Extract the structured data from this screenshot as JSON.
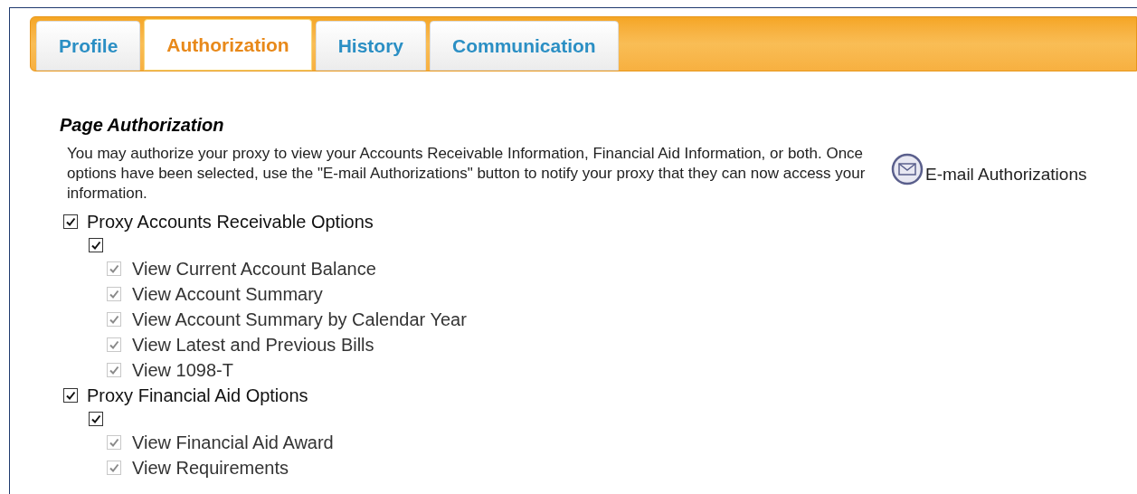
{
  "tabs": [
    {
      "label": "Profile",
      "selected": false
    },
    {
      "label": "Authorization",
      "selected": true
    },
    {
      "label": "History",
      "selected": false
    },
    {
      "label": "Communication",
      "selected": false
    }
  ],
  "section": {
    "title": "Page Authorization",
    "description": "You may authorize your proxy to view your Accounts Receivable Information, Financial Aid Information, or both. Once options have been selected, use the \"E-mail Authorizations\" button to notify your proxy that they can now access your information.",
    "email_button": "E-mail Authorizations"
  },
  "groups": [
    {
      "label": "Proxy Accounts Receivable Options",
      "checked": true,
      "select_all_checked": true,
      "options": [
        {
          "label": "View Current Account Balance",
          "checked": true,
          "disabled": true
        },
        {
          "label": "View Account Summary",
          "checked": true,
          "disabled": true
        },
        {
          "label": "View Account Summary by Calendar Year",
          "checked": true,
          "disabled": true
        },
        {
          "label": "View Latest and Previous Bills",
          "checked": true,
          "disabled": true
        },
        {
          "label": "View 1098-T",
          "checked": true,
          "disabled": true
        }
      ]
    },
    {
      "label": "Proxy Financial Aid Options",
      "checked": true,
      "select_all_checked": true,
      "options": [
        {
          "label": "View Financial Aid Award",
          "checked": true,
          "disabled": true
        },
        {
          "label": "View Requirements",
          "checked": true,
          "disabled": true
        }
      ]
    }
  ]
}
